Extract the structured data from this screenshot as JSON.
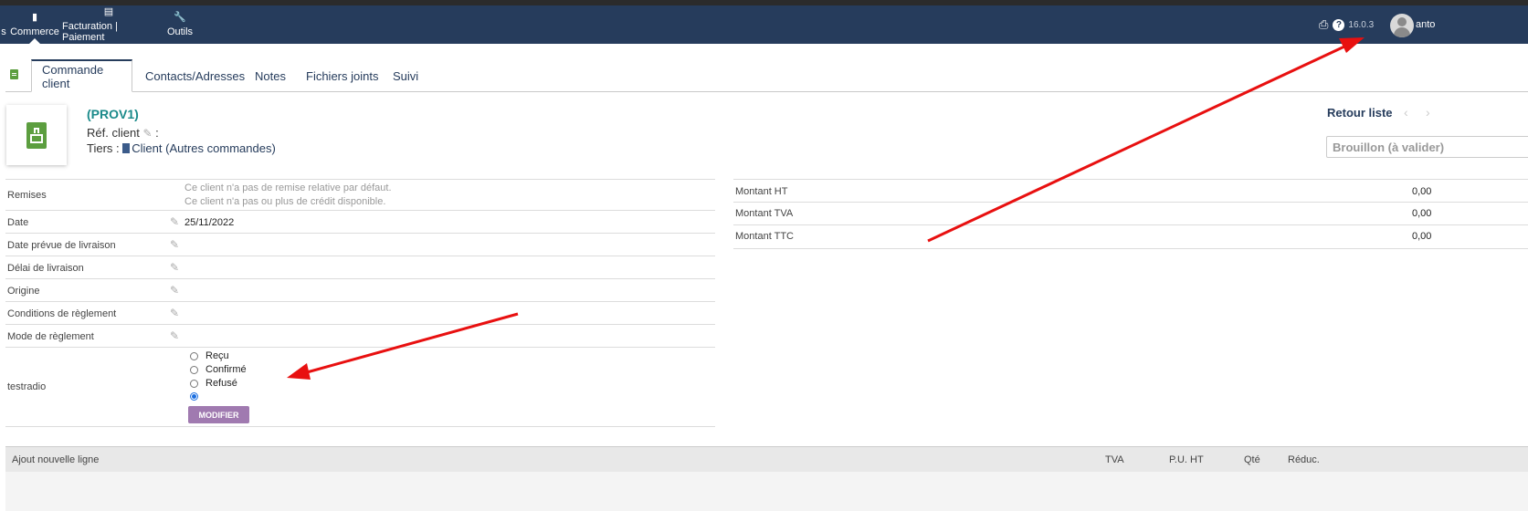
{
  "topbar": {
    "menu": [
      {
        "label": "s"
      },
      {
        "label": "Commerce",
        "icon": "briefcase-icon"
      },
      {
        "label": "Facturation | Paiement",
        "icon": "bank-icon"
      },
      {
        "label": "Outils",
        "icon": "wrench-icon"
      }
    ],
    "version": "16.0.3",
    "username": "anto"
  },
  "tabs": [
    "Commande client",
    "Contacts/Adresses",
    "Notes",
    "Fichiers joints",
    "Suivi"
  ],
  "header": {
    "ref": "(PROV1)",
    "ref_client_label": "Réf. client",
    "ref_client_colon": ":",
    "tiers_label": "Tiers :",
    "tiers_link": "Client",
    "tiers_extra": "(Autres commandes)",
    "retour_liste": "Retour liste",
    "status": "Brouillon (à valider)"
  },
  "fields": {
    "remises_label": "Remises",
    "remises_note1": "Ce client n'a pas de remise relative par défaut.",
    "remises_note2": "Ce client n'a pas ou plus de crédit disponible.",
    "date_label": "Date",
    "date_value": "25/11/2022",
    "date_livraison_label": "Date prévue de livraison",
    "delai_label": "Délai de livraison",
    "origine_label": "Origine",
    "conditions_label": "Conditions de règlement",
    "mode_label": "Mode de règlement",
    "testradio_label": "testradio",
    "radio_options": [
      "Reçu",
      "Confirmé",
      "Refusé",
      ""
    ],
    "radio_selected_index": 3,
    "modifier_button": "MODIFIER"
  },
  "totals": [
    {
      "label": "Montant HT",
      "value": "0,00"
    },
    {
      "label": "Montant TVA",
      "value": "0,00"
    },
    {
      "label": "Montant TTC",
      "value": "0,00"
    }
  ],
  "lines_header": {
    "add_line": "Ajout nouvelle ligne",
    "tva": "TVA",
    "pu_ht": "P.U. HT",
    "qte": "Qté",
    "reduc": "Réduc."
  },
  "colors": {
    "topbar": "#263c5c",
    "accent_ref": "#1a8a8a",
    "modifier_button": "#a07ab0",
    "annotation_arrow": "#e81010"
  }
}
